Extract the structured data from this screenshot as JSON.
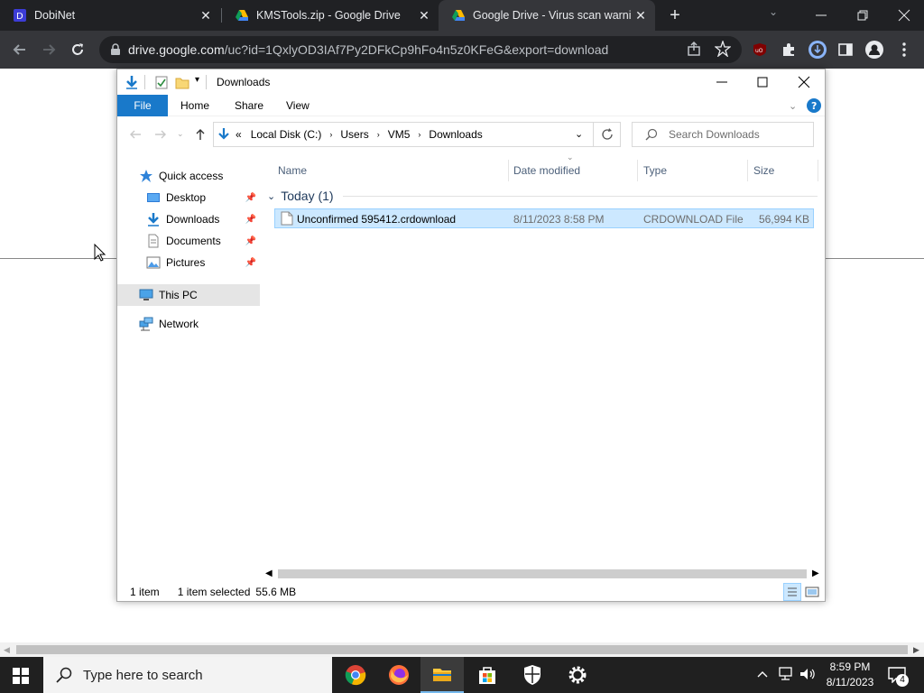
{
  "browser": {
    "tabs": [
      {
        "title": "DobiNet",
        "close": "✕"
      },
      {
        "title": "KMSTools.zip - Google Drive",
        "close": "✕"
      },
      {
        "title": "Google Drive - Virus scan warning",
        "close": "✕"
      }
    ],
    "new_tab": "+",
    "url_host": "drive.google.com",
    "url_path": "/uc?id=1QxlyOD3IAf7Py2DFkCp9hFo4n5z0KFeG&export=download",
    "colors": {
      "tabbar": "#202124",
      "toolbar": "#35363a"
    }
  },
  "explorer": {
    "title": "Downloads",
    "ribbon_tabs": [
      "File",
      "Home",
      "Share",
      "View"
    ],
    "breadcrumb": [
      "Local Disk (C:)",
      "Users",
      "VM5",
      "Downloads"
    ],
    "breadcrumb_prefix": "«",
    "search_placeholder": "Search Downloads",
    "nav": {
      "quick_access": "Quick access",
      "items": [
        "Desktop",
        "Downloads",
        "Documents",
        "Pictures"
      ],
      "this_pc": "This PC",
      "network": "Network"
    },
    "columns": [
      "Name",
      "Date modified",
      "Type",
      "Size"
    ],
    "group": "Today (1)",
    "files": [
      {
        "name": "Unconfirmed 595412.crdownload",
        "date": "8/11/2023 8:58 PM",
        "type": "CRDOWNLOAD File",
        "size": "56,994 KB"
      }
    ],
    "status": {
      "count": "1 item",
      "selected": "1 item selected",
      "size": "55.6 MB"
    },
    "colors": {
      "accent": "#1979ca",
      "selection": "#cce8ff",
      "selected_nav": "#e5e5e5"
    }
  },
  "taskbar": {
    "search_placeholder": "Type here to search",
    "time": "8:59 PM",
    "date": "8/11/2023",
    "notifications": "4"
  }
}
